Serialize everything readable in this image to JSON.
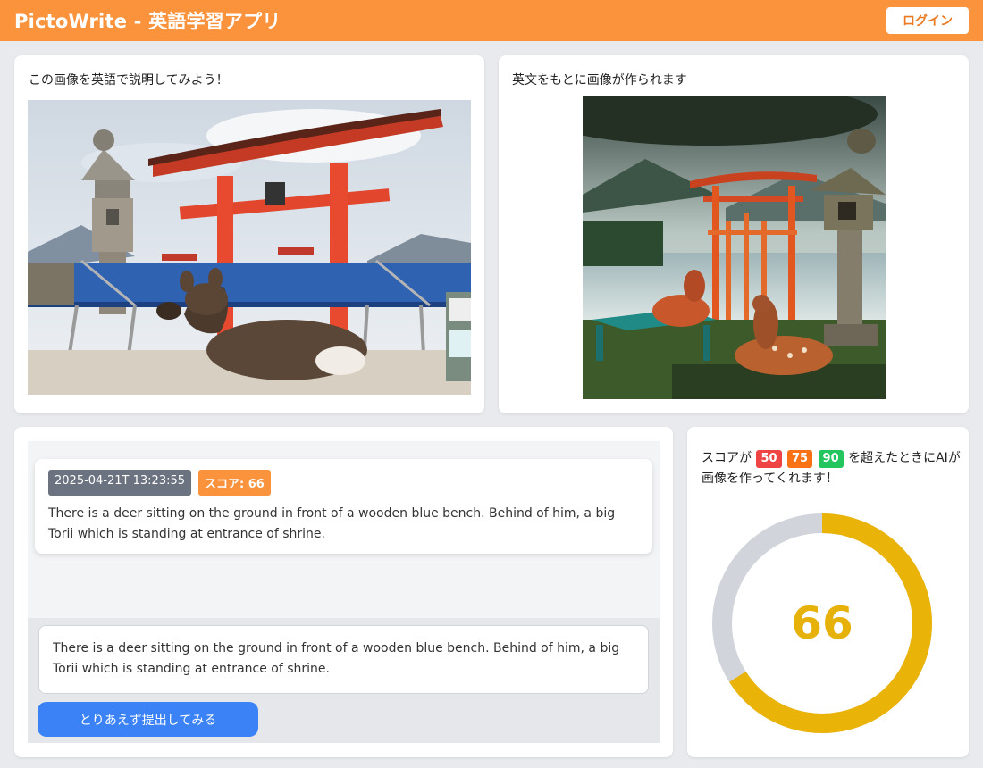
{
  "header": {
    "app_title": "PictoWrite - 英語学習アプリ",
    "login_label": "ログイン",
    "bg_color": "#fb923c"
  },
  "prompt_panel": {
    "title": "この画像を英語で説明してみよう！",
    "image_subject": "deer resting in front of blue bench with red torii gate"
  },
  "generated_panel": {
    "title": "英文をもとに画像が作られます",
    "image_subject": "AI generated image of deer near bench, torii gate and stone lantern by lake"
  },
  "history": {
    "items": [
      {
        "timestamp": "2025-04-21T 13:23:55",
        "score_label": "スコア: 66",
        "text": "There is a deer sitting on the ground in front of a wooden blue bench. Behind of him, a big Torii which is standing at entrance of shrine."
      }
    ]
  },
  "input": {
    "value": "There is a deer sitting on the ground in front of a wooden blue bench. Behind of him, a big Torii which is standing at entrance of shrine.",
    "submit_label": "とりあえず提出してみる"
  },
  "score_panel": {
    "prefix": "スコアが",
    "thresholds": [
      {
        "value": "50",
        "color": "#ef4444"
      },
      {
        "value": "75",
        "color": "#f97316"
      },
      {
        "value": "90",
        "color": "#22c55e"
      }
    ],
    "suffix": "を超えたときにAIが画像を作ってくれます！",
    "score": 66,
    "score_text": "66",
    "gauge_color": "#eab308",
    "track_color": "#d1d5db"
  }
}
